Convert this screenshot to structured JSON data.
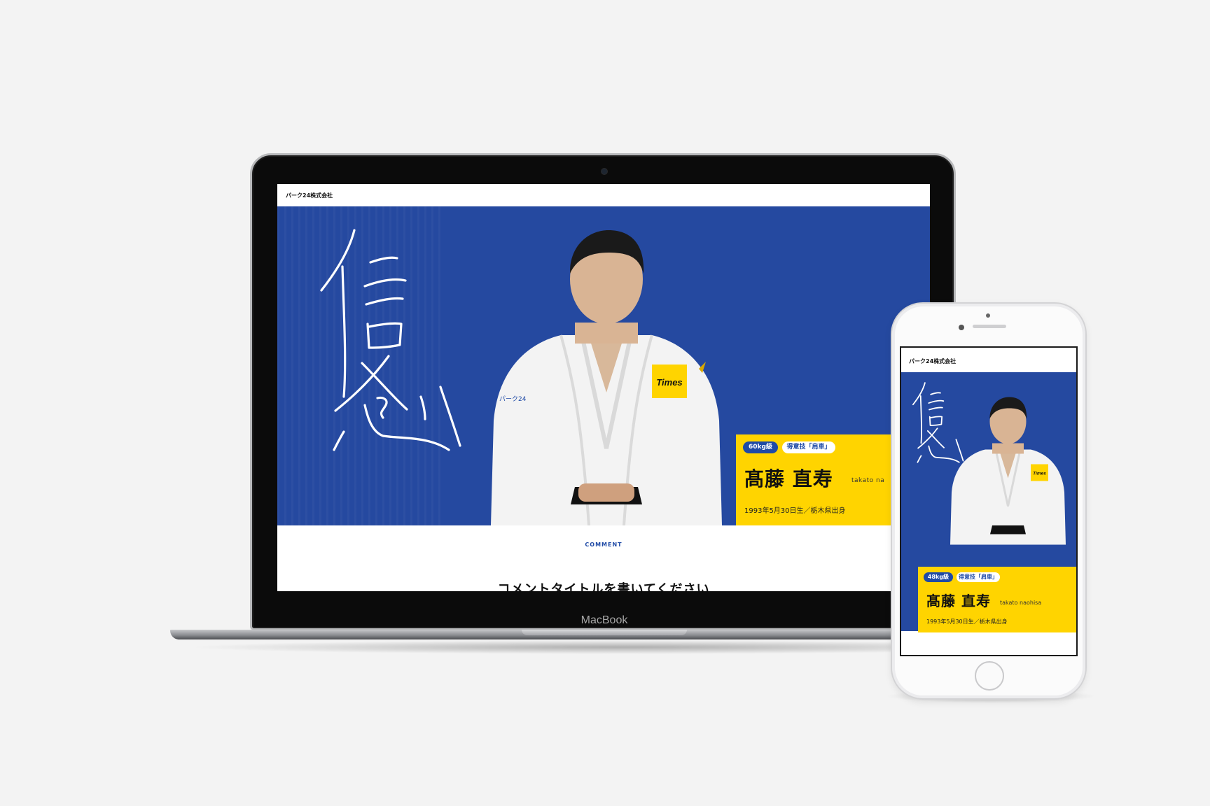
{
  "laptop": {
    "brand_label": "MacBook",
    "site": {
      "company_logo": "パーク24株式会社",
      "athlete": {
        "weight_class": "60kg級",
        "specialty": "得意技「肩車」",
        "name": "髙藤 直寿",
        "name_roman": "takato na",
        "birth_info": "1993年5月30日生／栃木県出身"
      },
      "comment": {
        "label": "COMMENT",
        "title": "コメントタイトルを書いてください"
      },
      "jacket_patch": "Times",
      "sleeve_text": "パーク24"
    }
  },
  "phone": {
    "site": {
      "company_logo": "パーク24株式会社",
      "athlete": {
        "weight_class": "48kg級",
        "specialty": "得意技「肩車」",
        "name": "髙藤 直寿",
        "name_roman": "takato naohisa",
        "birth_info": "1993年5月30日生／栃木県出身"
      },
      "jacket_patch": "Times"
    }
  },
  "colors": {
    "hero_blue": "#2549a0",
    "card_yellow": "#ffd400",
    "pill_blue": "#1f4aa6",
    "background": "#f3f3f3"
  }
}
